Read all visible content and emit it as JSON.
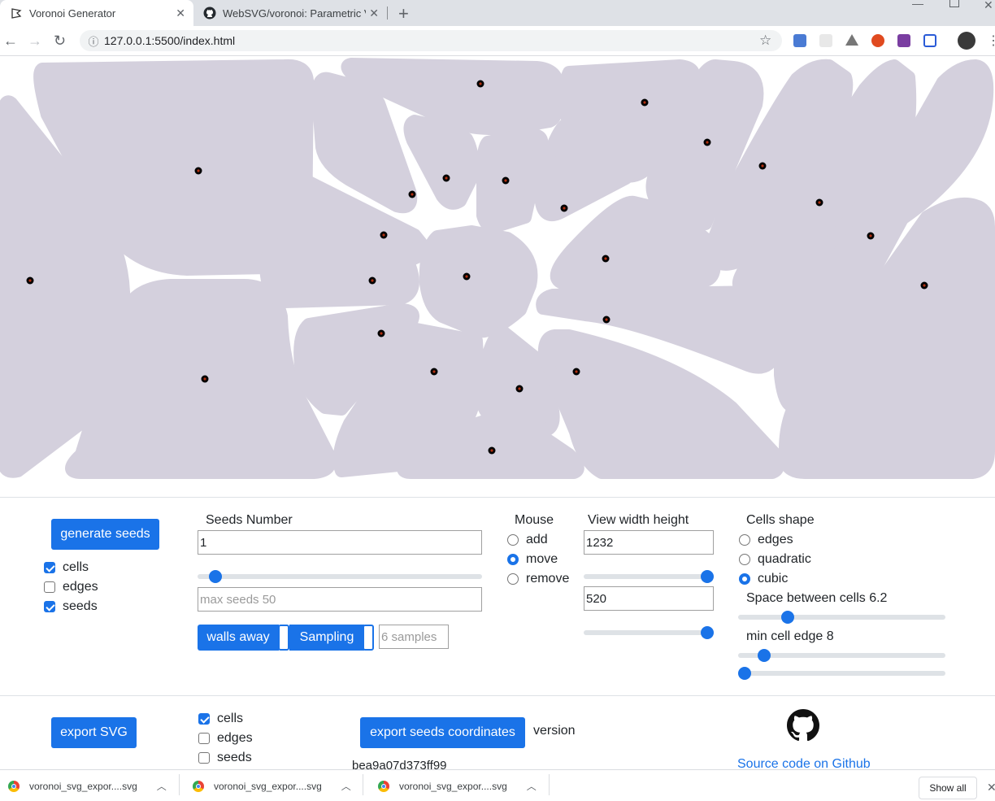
{
  "browser": {
    "tabs": [
      {
        "title": "Voronoi Generator",
        "favicon": "voronoi-icon"
      },
      {
        "title": "WebSVG/voronoi: Parametric Vor",
        "favicon": "github-icon"
      }
    ],
    "url": "127.0.0.1:5500/index.html"
  },
  "canvas": {
    "cell_color": "#d4d0dd",
    "seed_color": "#000000",
    "seed_inner_color": "#b03010"
  },
  "controls": {
    "generate_seeds": "generate seeds",
    "display": [
      {
        "label": "cells",
        "checked": true
      },
      {
        "label": "edges",
        "checked": false
      },
      {
        "label": "seeds",
        "checked": true
      }
    ],
    "seeds_number_label": "Seeds Number",
    "seeds_number_value": "1",
    "seeds_slider": 0.02,
    "max_seeds_placeholder": "max seeds 50",
    "walls_away": "walls away",
    "sampling": "Sampling",
    "samples_placeholder": "6 samples",
    "mouse_label": "Mouse",
    "mouse_modes": [
      {
        "label": "add",
        "checked": false
      },
      {
        "label": "move",
        "checked": true
      },
      {
        "label": "remove",
        "checked": false
      }
    ],
    "view_label": "View width height",
    "view_width": "1232",
    "view_width_slider": 1.0,
    "view_height": "520",
    "view_height_slider": 1.0,
    "cells_shape_label": "Cells shape",
    "cells_shapes": [
      {
        "label": "edges",
        "checked": false
      },
      {
        "label": "quadratic",
        "checked": false
      },
      {
        "label": "cubic",
        "checked": true
      }
    ],
    "space_label": "Space between cells 6.2",
    "space_slider": 0.22,
    "min_edge_label": "min cell edge 8",
    "min_edge_slider": 0.1,
    "third_slider": 0.0
  },
  "export": {
    "export_svg": "export SVG",
    "options": [
      {
        "label": "cells",
        "checked": true
      },
      {
        "label": "edges",
        "checked": false
      },
      {
        "label": "seeds",
        "checked": false
      }
    ],
    "export_seeds": "export seeds coordinates",
    "version_label": "version",
    "version_hash": "bea9a07d373ff99",
    "source_link": "Source code on Github"
  },
  "downloads": {
    "items": [
      "voronoi_svg_expor....svg",
      "voronoi_svg_expor....svg",
      "voronoi_svg_expor....svg"
    ],
    "show_all": "Show all"
  }
}
